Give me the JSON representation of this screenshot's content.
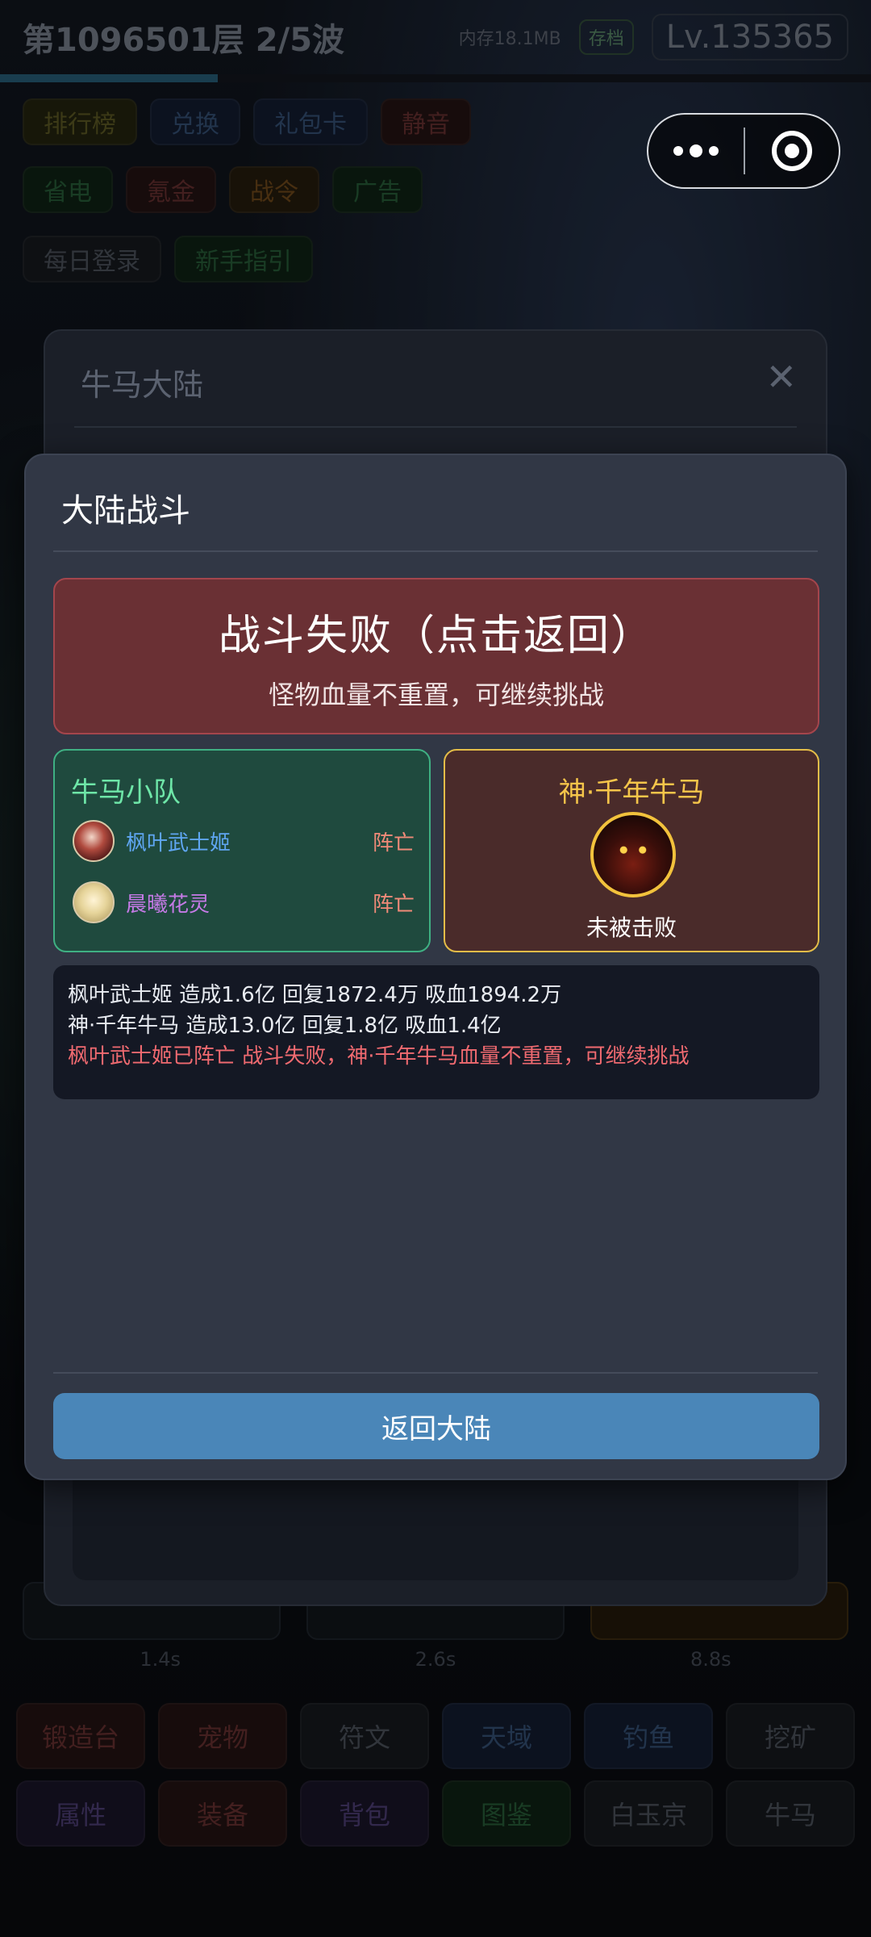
{
  "topbar": {
    "floor_title": "第1096501层  2/5波",
    "memory": "内存18.1MB",
    "save": "存档",
    "level": "Lv.135365",
    "wave_progress": 0.25
  },
  "menu_row_1": [
    "排行榜",
    "兑换",
    "礼包卡",
    "静音"
  ],
  "menu_row_2": [
    "省电",
    "氪金",
    "战令",
    "广告"
  ],
  "menu_row_3": [
    "每日登录",
    "新手指引"
  ],
  "timers": [
    "1.4s",
    "2.6s",
    "8.8s"
  ],
  "bottom_grid_row_1": [
    "锻造台",
    "宠物",
    "符文",
    "天域",
    "钓鱼",
    "挖矿"
  ],
  "bottom_grid_row_2": [
    "属性",
    "装备",
    "背包",
    "图鉴",
    "白玉京",
    "牛马"
  ],
  "back_modal": {
    "title": "牛马大陆",
    "close": "✕"
  },
  "battle_modal": {
    "title": "大陆战斗",
    "result": {
      "title": "战斗失败（点击返回）",
      "subtitle": "怪物血量不重置，可继续挑战"
    },
    "team": {
      "title": "牛马小队",
      "members": [
        {
          "name": "枫叶武士姬",
          "status": "阵亡"
        },
        {
          "name": "晨曦花灵",
          "status": "阵亡"
        }
      ]
    },
    "boss": {
      "name": "神·千年牛马",
      "state": "未被击败"
    },
    "log": [
      "枫叶武士姬 造成1.6亿 回复1872.4万 吸血1894.2万",
      "神·千年牛马 造成13.0亿 回复1.8亿 吸血1.4亿",
      "枫叶武士姬已阵亡 战斗失败，神·千年牛马血量不重置，可继续挑战"
    ],
    "return_button": "返回大陆"
  },
  "colors": {
    "failure_banner": "#6a3034",
    "team_border": "#3fb083",
    "boss_border": "#e4bd48",
    "return_button": "#4a86b8"
  }
}
